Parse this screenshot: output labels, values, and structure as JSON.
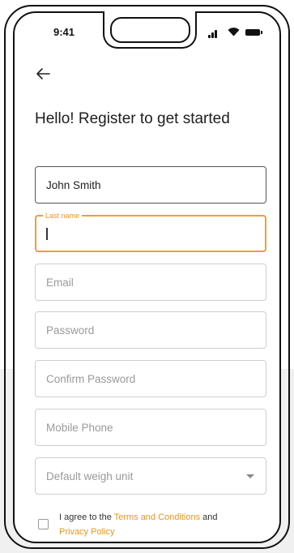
{
  "status": {
    "time": "9:41"
  },
  "header": {
    "title": "Hello! Register to get started"
  },
  "form": {
    "first_name_value": "John Smith",
    "last_name_label": "Last name",
    "email_placeholder": "Email",
    "password_placeholder": "Password",
    "confirm_password_placeholder": "Confirm Password",
    "mobile_phone_placeholder": "Mobile Phone",
    "weigh_unit_placeholder": "Default weigh unit"
  },
  "agreement": {
    "prefix": "I agree to the ",
    "terms_link": "Terms and Conditions",
    "and": " and ",
    "privacy_link": "Privacy Policy"
  },
  "colors": {
    "accent": "#e8961e",
    "text": "#1e1e1e",
    "placeholder": "#9a9a9a"
  },
  "icons": [
    "back-arrow-icon",
    "signal-icon",
    "wifi-icon",
    "battery-icon",
    "dropdown-arrow-icon",
    "checkbox-icon"
  ]
}
